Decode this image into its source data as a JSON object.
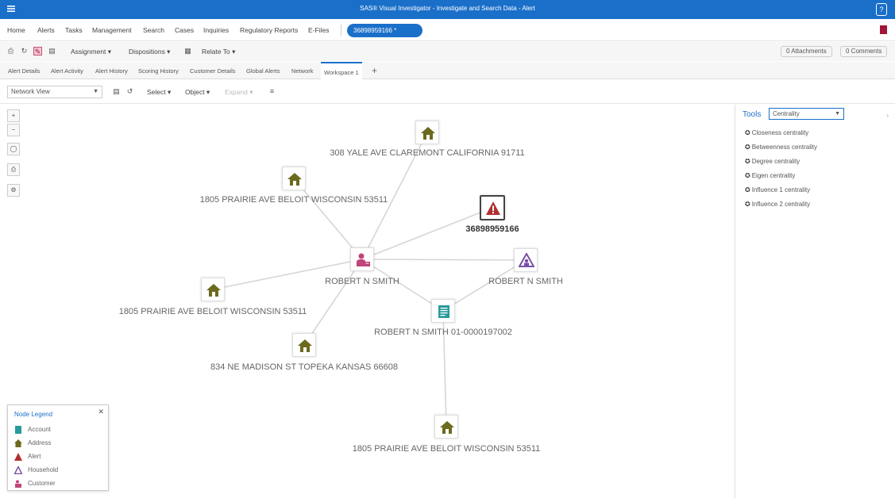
{
  "window": {
    "title": "SAS® Visual Investigator - Investigate and Search Data - Alert"
  },
  "menu": {
    "items": [
      "Home",
      "Alerts",
      "Tasks",
      "Management",
      "Search",
      "Cases",
      "Inquiries",
      "Regulatory Reports",
      "E-Files"
    ],
    "alert_pill": "36898959166 *"
  },
  "toolbar": {
    "assignment": "Assignment ▾",
    "dispositions": "Dispositions ▾",
    "relate_to": "Relate To ▾",
    "attachments": "0 Attachments",
    "comments": "0 Comments"
  },
  "tabs": [
    "Alert Details",
    "Alert Activity",
    "Alert History",
    "Scoring History",
    "Customer Details",
    "Global Alerts",
    "Network",
    "Workspace 1"
  ],
  "subtoolbar": {
    "view": "Network View",
    "select": "Select ▾",
    "object": "Object ▾",
    "expand": "Expand ▾"
  },
  "network": {
    "nodes": {
      "addr_yale": "308 YALE AVE CLAREMONT CALIFORNIA 91711",
      "addr_prairie_top": "1805 PRAIRIE AVE BELOIT WISCONSIN 53511",
      "alert": "36898959166",
      "customer": "ROBERT N SMITH",
      "household": "ROBERT N SMITH",
      "addr_prairie_left": "1805 PRAIRIE AVE BELOIT WISCONSIN 53511",
      "account": "ROBERT N SMITH 01-0000197002",
      "addr_madison": "834 NE MADISON ST TOPEKA KANSAS 66608",
      "addr_prairie_bottom": "1805 PRAIRIE AVE BELOIT WISCONSIN 53511"
    }
  },
  "legend": {
    "title": "Node Legend",
    "items": [
      "Account",
      "Address",
      "Alert",
      "Household",
      "Customer"
    ]
  },
  "tools": {
    "label": "Tools",
    "selected": "Centrality",
    "options": [
      "Closeness centrality",
      "Betweenness centrality",
      "Degree centrality",
      "Eigen centrality",
      "Influence 1 centrality",
      "Influence 2 centrality"
    ]
  },
  "colors": {
    "brand": "#1a6fc9",
    "address": "#6b6a1e",
    "alert": "#b03030",
    "customer": "#c0447a",
    "household": "#7a4fa8",
    "account": "#2a9a9a"
  }
}
